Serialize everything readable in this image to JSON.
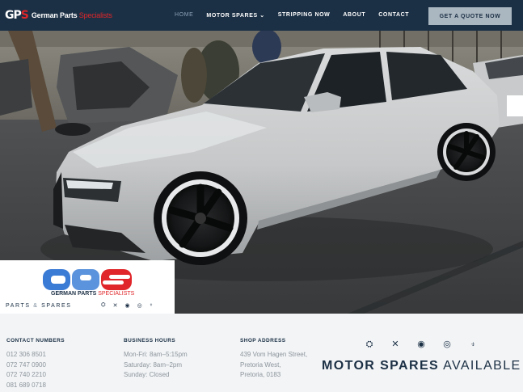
{
  "brand": {
    "mark_prefix": "GP",
    "mark_suffix": "S",
    "name_white": "German Parts ",
    "name_red": "Specialists"
  },
  "nav": {
    "items": [
      {
        "label": "HOME",
        "active": true
      },
      {
        "label": "MOTOR SPARES ⌄",
        "active": false
      },
      {
        "label": "STRIPPING NOW",
        "active": false
      },
      {
        "label": "ABOUT",
        "active": false
      },
      {
        "label": "CONTACT",
        "active": false
      }
    ],
    "cta": "GET A QUOTE NOW"
  },
  "card": {
    "sub_left": "GERMAN PARTS ",
    "sub_right": "SPECIALISTS",
    "tag_a": "PARTS",
    "tag_amp": "&",
    "tag_b": "SPARES"
  },
  "footer": {
    "contact": {
      "heading": "CONTACT NUMBERS",
      "lines": [
        "012 306 8501",
        "072 747 0900",
        "072 740 2210",
        "081 689 0718"
      ]
    },
    "hours": {
      "heading": "BUSINESS HOURS",
      "lines": [
        "Mon-Fri: 8am–5:15pm",
        "Saturday: 8am–2pm",
        "Sunday: Closed"
      ]
    },
    "address": {
      "heading": "SHOP ADDRESS",
      "lines": [
        "439 Vom Hagen Street,",
        "Pretoria West,",
        "Pretoria, 0183"
      ]
    }
  },
  "motor_spares": {
    "word_bold": "MOTOR SPARES",
    "word_light": "AVAILABLE",
    "icons": [
      "engine-icon",
      "suspension-icon",
      "turbo-icon",
      "brake-disc-icon",
      "spark-plug-icon"
    ]
  },
  "colors": {
    "navy": "#1c3045",
    "red": "#e0262a",
    "button": "#aab6c0"
  }
}
